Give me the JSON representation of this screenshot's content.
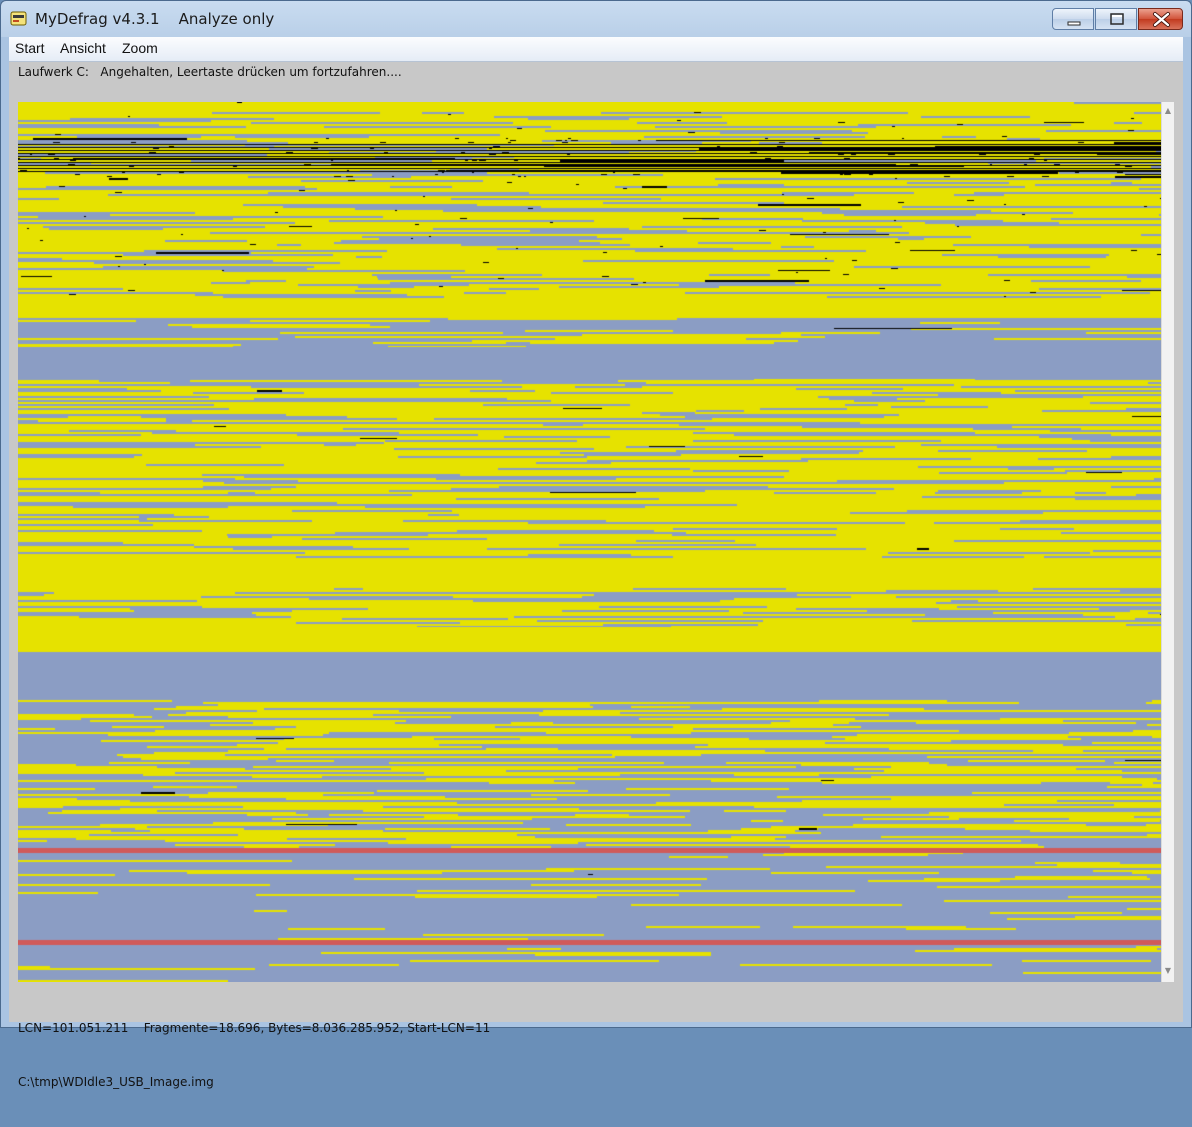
{
  "window": {
    "title": "MyDefrag v4.3.1    Analyze only",
    "icon": "mydefrag-app-icon",
    "buttons": {
      "minimize": "minimize-icon",
      "maximize": "maximize-icon",
      "close": "close-icon"
    }
  },
  "menu": {
    "items": [
      "Start",
      "Ansicht",
      "Zoom"
    ]
  },
  "status": {
    "top": "Laufwerk C:   Angehalten, Leertaste drücken um fortzufahren....",
    "bottom_line1": "LCN=101.051.211    Fragmente=18.696, Bytes=8.036.285.952, Start-LCN=11",
    "bottom_line2": "C:\\tmp\\WDIdle3_USB_Image.img"
  },
  "diskmap": {
    "colors": {
      "free": "#8b9dc4",
      "used": "#e6e200",
      "fragmented": "#000000",
      "highlight": "#d05a5a"
    }
  }
}
